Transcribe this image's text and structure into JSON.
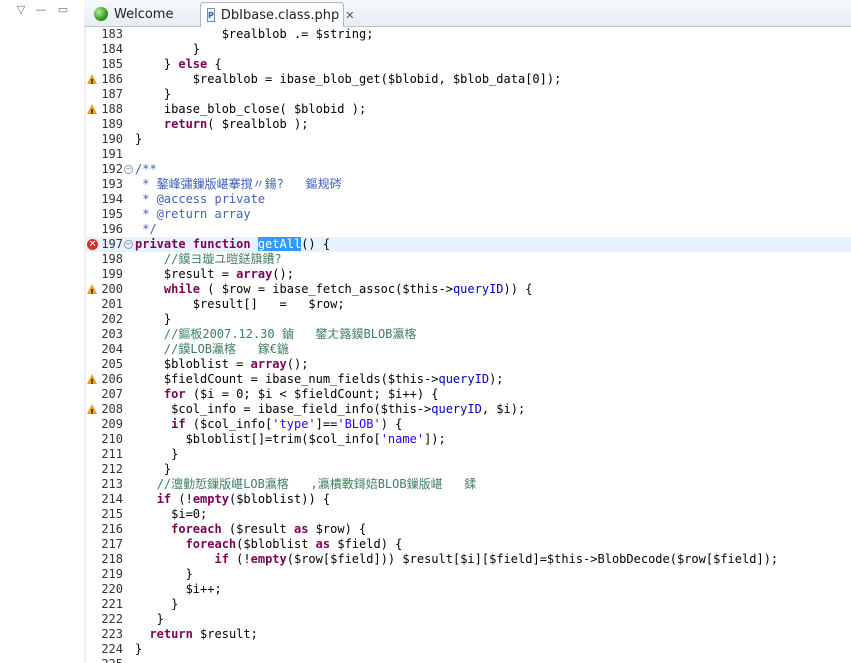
{
  "left_pane": {
    "controls": [
      "▽",
      "—",
      "▭"
    ]
  },
  "tabs": [
    {
      "label": "Welcome",
      "icon": "globe-icon",
      "active": false
    },
    {
      "label": "DbIbase.class.php",
      "icon": "php-file-icon",
      "active": true,
      "close": "✕"
    }
  ],
  "editor": {
    "current_line": 197,
    "lines": [
      {
        "n": "183",
        "marker": "",
        "fold": "",
        "segs": [
          [
            "",
            "            "
          ],
          [
            "var",
            "$realblob"
          ],
          [
            "",
            " .= "
          ],
          [
            "var",
            "$string"
          ],
          [
            "",
            ";"
          ]
        ]
      },
      {
        "n": "184",
        "marker": "",
        "fold": "",
        "segs": [
          [
            "",
            "        }"
          ]
        ]
      },
      {
        "n": "185",
        "marker": "",
        "fold": "",
        "segs": [
          [
            "",
            "    } "
          ],
          [
            "kw",
            "else"
          ],
          [
            "",
            " {"
          ]
        ]
      },
      {
        "n": "186",
        "marker": "warn",
        "fold": "",
        "segs": [
          [
            "",
            "        "
          ],
          [
            "var",
            "$realblob"
          ],
          [
            "",
            " = "
          ],
          [
            "fn",
            "ibase_blob_get"
          ],
          [
            "",
            "("
          ],
          [
            "var",
            "$blobid"
          ],
          [
            "",
            ", "
          ],
          [
            "var",
            "$blob_data"
          ],
          [
            "",
            "[0]);"
          ]
        ]
      },
      {
        "n": "187",
        "marker": "",
        "fold": "",
        "segs": [
          [
            "",
            "    }"
          ]
        ]
      },
      {
        "n": "188",
        "marker": "warn",
        "fold": "",
        "segs": [
          [
            "",
            "    "
          ],
          [
            "fn",
            "ibase_blob_close"
          ],
          [
            "",
            "( "
          ],
          [
            "var",
            "$blobid"
          ],
          [
            "",
            " );"
          ]
        ]
      },
      {
        "n": "189",
        "marker": "",
        "fold": "",
        "segs": [
          [
            "",
            "    "
          ],
          [
            "kw",
            "return"
          ],
          [
            "",
            "( "
          ],
          [
            "var",
            "$realblob"
          ],
          [
            "",
            " );"
          ]
        ]
      },
      {
        "n": "190",
        "marker": "",
        "fold": "",
        "segs": [
          [
            "",
            "}"
          ]
        ]
      },
      {
        "n": "191",
        "marker": "",
        "fold": "",
        "segs": [
          [
            "",
            ""
          ]
        ]
      },
      {
        "n": "192",
        "marker": "",
        "fold": "⊖",
        "segs": [
          [
            "cmt",
            "/**"
          ]
        ]
      },
      {
        "n": "193",
        "marker": "",
        "fold": "",
        "segs": [
          [
            "cmt",
            " * 鏊峰彇鏁版嵁搴撹〃鍚?   鏂规硶"
          ]
        ]
      },
      {
        "n": "194",
        "marker": "",
        "fold": "",
        "segs": [
          [
            "cmt",
            " * @access private"
          ]
        ]
      },
      {
        "n": "195",
        "marker": "",
        "fold": "",
        "segs": [
          [
            "cmt",
            " * @return array"
          ]
        ]
      },
      {
        "n": "196",
        "marker": "",
        "fold": "",
        "segs": [
          [
            "cmt",
            " */"
          ]
        ]
      },
      {
        "n": "197",
        "marker": "err",
        "fold": "⊖",
        "segs": [
          [
            "kw",
            "private function"
          ],
          [
            "",
            " "
          ],
          [
            "sel",
            "getAll"
          ],
          [
            "",
            "() {"
          ]
        ]
      },
      {
        "n": "198",
        "marker": "",
        "fold": "",
        "segs": [
          [
            "",
            "    "
          ],
          [
            "cmt2",
            "//鏌ヨ璇ユ暟鎹簱鐨?"
          ]
        ]
      },
      {
        "n": "199",
        "marker": "",
        "fold": "",
        "segs": [
          [
            "",
            "    "
          ],
          [
            "var",
            "$result"
          ],
          [
            "",
            " = "
          ],
          [
            "kw",
            "array"
          ],
          [
            "",
            "();"
          ]
        ]
      },
      {
        "n": "200",
        "marker": "warn",
        "fold": "",
        "segs": [
          [
            "",
            "    "
          ],
          [
            "kw",
            "while"
          ],
          [
            "",
            " ( "
          ],
          [
            "var",
            "$row"
          ],
          [
            "",
            " = "
          ],
          [
            "fn",
            "ibase_fetch_assoc"
          ],
          [
            "",
            "("
          ],
          [
            "var",
            "$this"
          ],
          [
            "",
            "->"
          ],
          [
            "fld",
            "queryID"
          ],
          [
            "",
            ")) {"
          ]
        ]
      },
      {
        "n": "201",
        "marker": "",
        "fold": "",
        "segs": [
          [
            "",
            "        "
          ],
          [
            "var",
            "$result"
          ],
          [
            "",
            "[]   =   "
          ],
          [
            "var",
            "$row"
          ],
          [
            "",
            ";"
          ]
        ]
      },
      {
        "n": "202",
        "marker": "",
        "fold": "",
        "segs": [
          [
            "",
            "    }"
          ]
        ]
      },
      {
        "n": "203",
        "marker": "",
        "fold": "",
        "segs": [
          [
            "",
            "    "
          ],
          [
            "cmt2",
            "//鏂板2007.12.30 鏀   鐢ㄤ簬鏌BLOB瀛楁"
          ]
        ]
      },
      {
        "n": "204",
        "marker": "",
        "fold": "",
        "segs": [
          [
            "",
            "    "
          ],
          [
            "cmt2",
            "//鏌LOB瀛楁   鎵€鍦"
          ]
        ]
      },
      {
        "n": "205",
        "marker": "",
        "fold": "",
        "segs": [
          [
            "",
            "    "
          ],
          [
            "var",
            "$bloblist"
          ],
          [
            "",
            " = "
          ],
          [
            "kw",
            "array"
          ],
          [
            "",
            "();"
          ]
        ]
      },
      {
        "n": "206",
        "marker": "warn",
        "fold": "",
        "segs": [
          [
            "",
            "    "
          ],
          [
            "var",
            "$fieldCount"
          ],
          [
            "",
            " = "
          ],
          [
            "fn",
            "ibase_num_fields"
          ],
          [
            "",
            "("
          ],
          [
            "var",
            "$this"
          ],
          [
            "",
            "->"
          ],
          [
            "fld",
            "queryID"
          ],
          [
            "",
            ");"
          ]
        ]
      },
      {
        "n": "207",
        "marker": "",
        "fold": "",
        "segs": [
          [
            "",
            "    "
          ],
          [
            "kw",
            "for"
          ],
          [
            "",
            " ("
          ],
          [
            "var",
            "$i"
          ],
          [
            "",
            " = 0; "
          ],
          [
            "var",
            "$i"
          ],
          [
            "",
            " < "
          ],
          [
            "var",
            "$fieldCount"
          ],
          [
            "",
            "; "
          ],
          [
            "var",
            "$i"
          ],
          [
            "",
            "++) {"
          ]
        ]
      },
      {
        "n": "208",
        "marker": "warn",
        "fold": "",
        "segs": [
          [
            "",
            "     "
          ],
          [
            "var",
            "$col_info"
          ],
          [
            "",
            " = "
          ],
          [
            "fn",
            "ibase_field_info"
          ],
          [
            "",
            "("
          ],
          [
            "var",
            "$this"
          ],
          [
            "",
            "->"
          ],
          [
            "fld",
            "queryID"
          ],
          [
            "",
            ", "
          ],
          [
            "var",
            "$i"
          ],
          [
            "",
            ");"
          ]
        ]
      },
      {
        "n": "209",
        "marker": "",
        "fold": "",
        "segs": [
          [
            "",
            "     "
          ],
          [
            "kw",
            "if"
          ],
          [
            "",
            " ("
          ],
          [
            "var",
            "$col_info"
          ],
          [
            "",
            "["
          ],
          [
            "str",
            "'type'"
          ],
          [
            "",
            "]=="
          ],
          [
            "str",
            "'BLOB'"
          ],
          [
            "",
            ") {"
          ]
        ]
      },
      {
        "n": "210",
        "marker": "",
        "fold": "",
        "segs": [
          [
            "",
            "       "
          ],
          [
            "var",
            "$bloblist"
          ],
          [
            "",
            "[]="
          ],
          [
            "fn",
            "trim"
          ],
          [
            "",
            "("
          ],
          [
            "var",
            "$col_info"
          ],
          [
            "",
            "["
          ],
          [
            "str",
            "'name'"
          ],
          [
            "",
            "]);"
          ]
        ]
      },
      {
        "n": "211",
        "marker": "",
        "fold": "",
        "segs": [
          [
            "",
            "     }"
          ]
        ]
      },
      {
        "n": "212",
        "marker": "",
        "fold": "",
        "segs": [
          [
            "",
            "    }"
          ]
        ]
      },
      {
        "n": "213",
        "marker": "",
        "fold": "",
        "segs": [
          [
            "",
            "   "
          ],
          [
            "cmt2",
            "//澶勭悊鏁版嵁LOB瀛楁   ,瀛樻斁鎶婄BLOB鏁版嵁   鍒"
          ]
        ]
      },
      {
        "n": "214",
        "marker": "",
        "fold": "",
        "segs": [
          [
            "",
            "   "
          ],
          [
            "kw",
            "if"
          ],
          [
            "",
            " (!"
          ],
          [
            "kw",
            "empty"
          ],
          [
            "",
            "("
          ],
          [
            "var",
            "$bloblist"
          ],
          [
            "",
            ")) {"
          ]
        ]
      },
      {
        "n": "215",
        "marker": "",
        "fold": "",
        "segs": [
          [
            "",
            "     "
          ],
          [
            "var",
            "$i"
          ],
          [
            "",
            "=0;"
          ]
        ]
      },
      {
        "n": "216",
        "marker": "",
        "fold": "",
        "segs": [
          [
            "",
            "     "
          ],
          [
            "kw",
            "foreach"
          ],
          [
            "",
            " ("
          ],
          [
            "var",
            "$result"
          ],
          [
            "",
            " "
          ],
          [
            "kw",
            "as"
          ],
          [
            "",
            " "
          ],
          [
            "var",
            "$row"
          ],
          [
            "",
            ") {"
          ]
        ]
      },
      {
        "n": "217",
        "marker": "",
        "fold": "",
        "segs": [
          [
            "",
            "       "
          ],
          [
            "kw",
            "foreach"
          ],
          [
            "",
            "("
          ],
          [
            "var",
            "$bloblist"
          ],
          [
            "",
            " "
          ],
          [
            "kw",
            "as"
          ],
          [
            "",
            " "
          ],
          [
            "var",
            "$field"
          ],
          [
            "",
            ") {"
          ]
        ]
      },
      {
        "n": "218",
        "marker": "",
        "fold": "",
        "segs": [
          [
            "",
            "           "
          ],
          [
            "kw",
            "if"
          ],
          [
            "",
            " (!"
          ],
          [
            "kw",
            "empty"
          ],
          [
            "",
            "("
          ],
          [
            "var",
            "$row"
          ],
          [
            "",
            "["
          ],
          [
            "var",
            "$field"
          ],
          [
            "",
            "])) "
          ],
          [
            "var",
            "$result"
          ],
          [
            "",
            "["
          ],
          [
            "var",
            "$i"
          ],
          [
            "",
            "]["
          ],
          [
            "var",
            "$field"
          ],
          [
            "",
            "]="
          ],
          [
            "var",
            "$this"
          ],
          [
            "",
            "->BlobDecode("
          ],
          [
            "var",
            "$row"
          ],
          [
            "",
            "["
          ],
          [
            "var",
            "$field"
          ],
          [
            "",
            "]);"
          ]
        ]
      },
      {
        "n": "219",
        "marker": "",
        "fold": "",
        "segs": [
          [
            "",
            "       }"
          ]
        ]
      },
      {
        "n": "220",
        "marker": "",
        "fold": "",
        "segs": [
          [
            "",
            "       "
          ],
          [
            "var",
            "$i"
          ],
          [
            "",
            "++;"
          ]
        ]
      },
      {
        "n": "221",
        "marker": "",
        "fold": "",
        "segs": [
          [
            "",
            "     }"
          ]
        ]
      },
      {
        "n": "222",
        "marker": "",
        "fold": "",
        "segs": [
          [
            "",
            "   }"
          ]
        ]
      },
      {
        "n": "223",
        "marker": "",
        "fold": "",
        "segs": [
          [
            "",
            "  "
          ],
          [
            "kw",
            "return"
          ],
          [
            "",
            " "
          ],
          [
            "var",
            "$result"
          ],
          [
            "",
            ";"
          ]
        ]
      },
      {
        "n": "224",
        "marker": "",
        "fold": "",
        "segs": [
          [
            "",
            "}"
          ]
        ]
      },
      {
        "n": "225",
        "marker": "",
        "fold": "",
        "segs": [
          [
            "",
            ""
          ]
        ]
      }
    ]
  }
}
